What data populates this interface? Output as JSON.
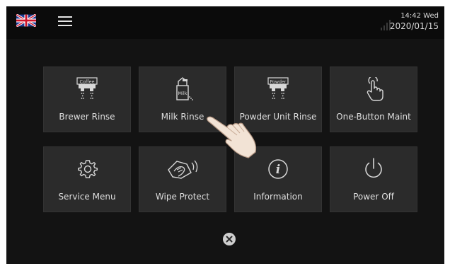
{
  "statusbar": {
    "language_icon": "uk-flag-icon",
    "menu_icon": "hamburger-menu-icon",
    "signal_icon": "signal-strength-icon",
    "time": "14:42 Wed",
    "date": "2020/01/15"
  },
  "menu": {
    "tiles": [
      {
        "label": "Brewer Rinse",
        "icon": "coffee-brewer-icon",
        "icon_text": "Coffee"
      },
      {
        "label": "Milk Rinse",
        "icon": "milk-carton-icon",
        "icon_text": "Milk"
      },
      {
        "label": "Powder Unit Rinse",
        "icon": "powder-unit-icon",
        "icon_text": "Powder"
      },
      {
        "label": "One-Button Maint",
        "icon": "touch-hand-icon"
      },
      {
        "label": "Service Menu",
        "icon": "gear-icon"
      },
      {
        "label": "Wipe Protect",
        "icon": "wipe-hand-icon"
      },
      {
        "label": "Information",
        "icon": "info-icon",
        "icon_text": "i"
      },
      {
        "label": "Power Off",
        "icon": "power-icon"
      }
    ],
    "close_icon": "close-icon"
  },
  "colors": {
    "background": "#131313",
    "tile": "#2b2b2b",
    "text": "#dedede"
  }
}
